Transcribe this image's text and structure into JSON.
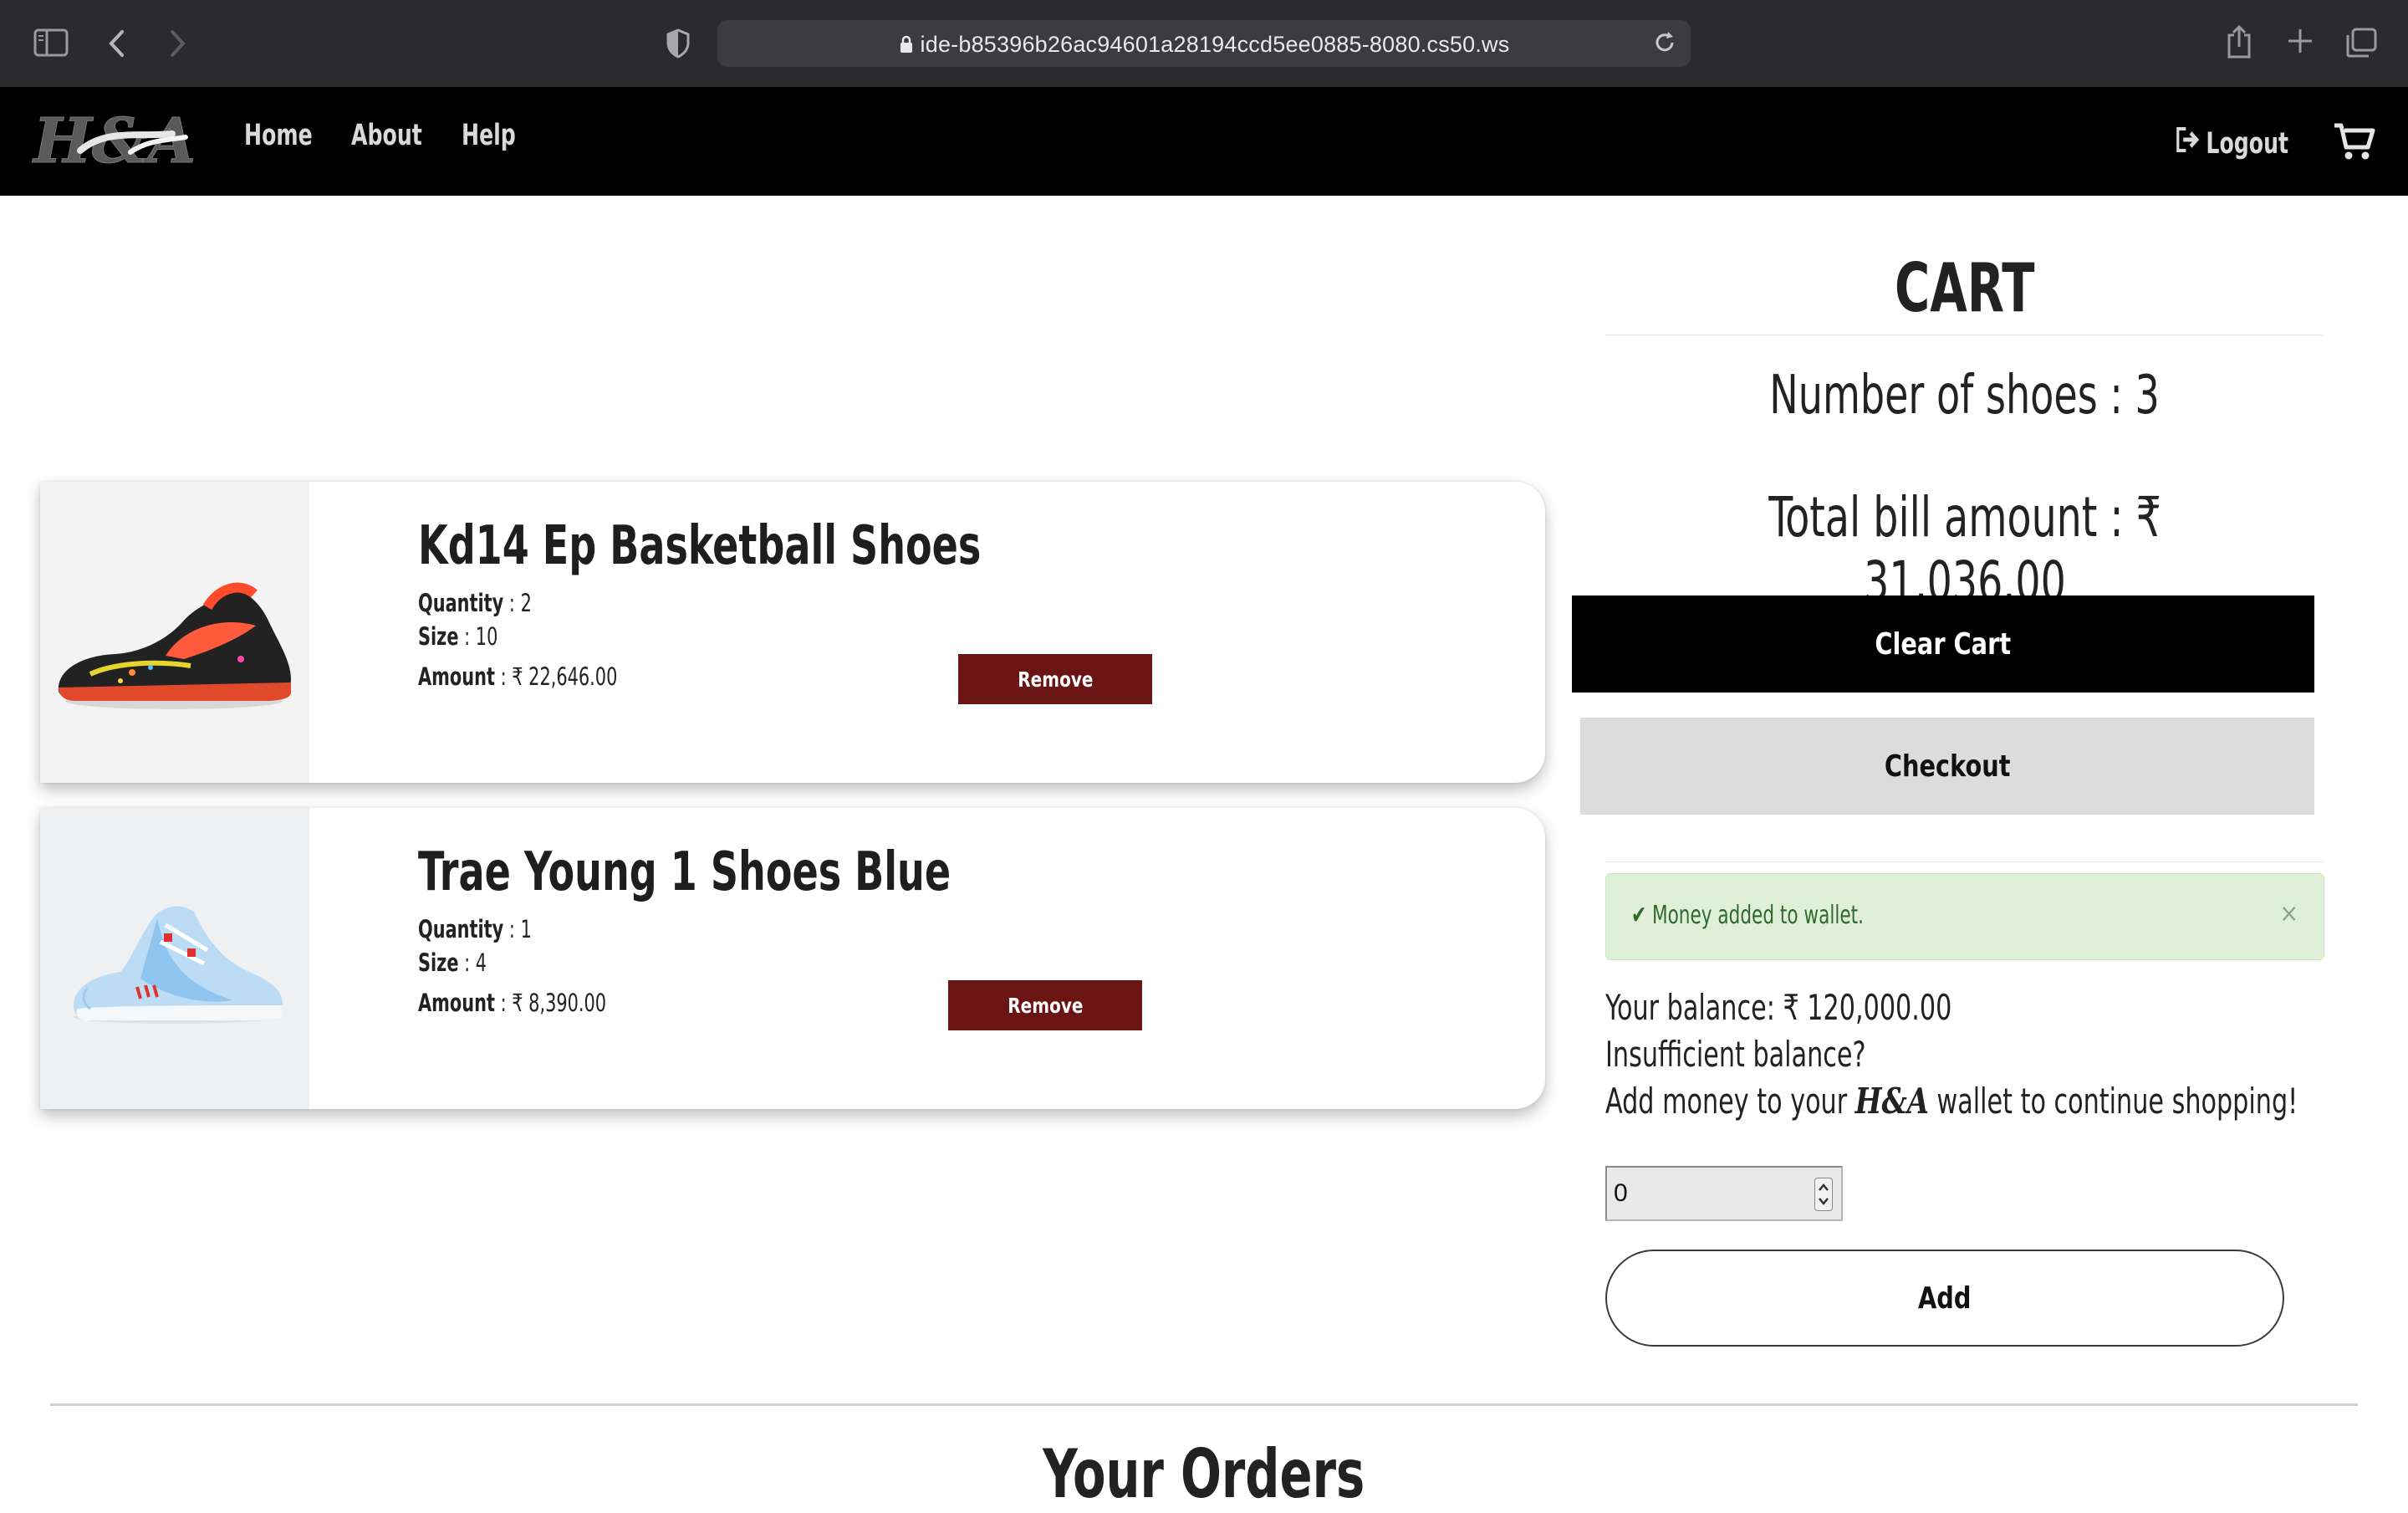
{
  "browser": {
    "url": "ide-b85396b26ac94601a28194ccd5ee0885-8080.cs50.ws",
    "icons": [
      "sidebar-icon",
      "back-icon",
      "forward-icon",
      "shield-icon",
      "lock-icon",
      "reload-icon",
      "share-icon",
      "new-tab-icon",
      "tabs-overview-icon"
    ]
  },
  "navbar": {
    "logo_text": "H&A",
    "links": [
      {
        "label": "Home"
      },
      {
        "label": "About"
      },
      {
        "label": "Help"
      }
    ],
    "logout_label": "Logout",
    "cart_icon": "cart-icon"
  },
  "cart_items": [
    {
      "name": "Kd14 Ep Basketball Shoes",
      "quantity_label": "Quantity",
      "quantity": "2",
      "size_label": "Size",
      "size": "10",
      "amount_label": "Amount",
      "amount": "₹ 22,646.00",
      "remove_label": "Remove"
    },
    {
      "name": "Trae Young 1 Shoes Blue",
      "quantity_label": "Quantity",
      "quantity": "1",
      "size_label": "Size",
      "size": "4",
      "amount_label": "Amount",
      "amount": "₹ 8,390.00",
      "remove_label": "Remove"
    }
  ],
  "cart": {
    "title": "CART",
    "number_of_shoes": "Number of shoes : 3",
    "total_bill": "Total bill amount : ₹ 31,036.00",
    "clear_cart_label": "Clear Cart",
    "checkout_label": "Checkout"
  },
  "alert": {
    "message": "✔ Money added to wallet.",
    "close": "×"
  },
  "wallet": {
    "balance": "Your balance: ₹ 120,000.00",
    "insufficient": "Insufficient balance?",
    "add_prefix": "Add money to your",
    "brand": "H&A",
    "add_suffix": "wallet to continue shopping!",
    "input_value": "0",
    "add_label": "Add"
  },
  "orders": {
    "title": "Your Orders"
  },
  "colors": {
    "navbar_bg": "#000000",
    "remove_btn": "#6b1414",
    "alert_bg": "#e0f0d8",
    "alert_text": "#2e6a2e"
  }
}
